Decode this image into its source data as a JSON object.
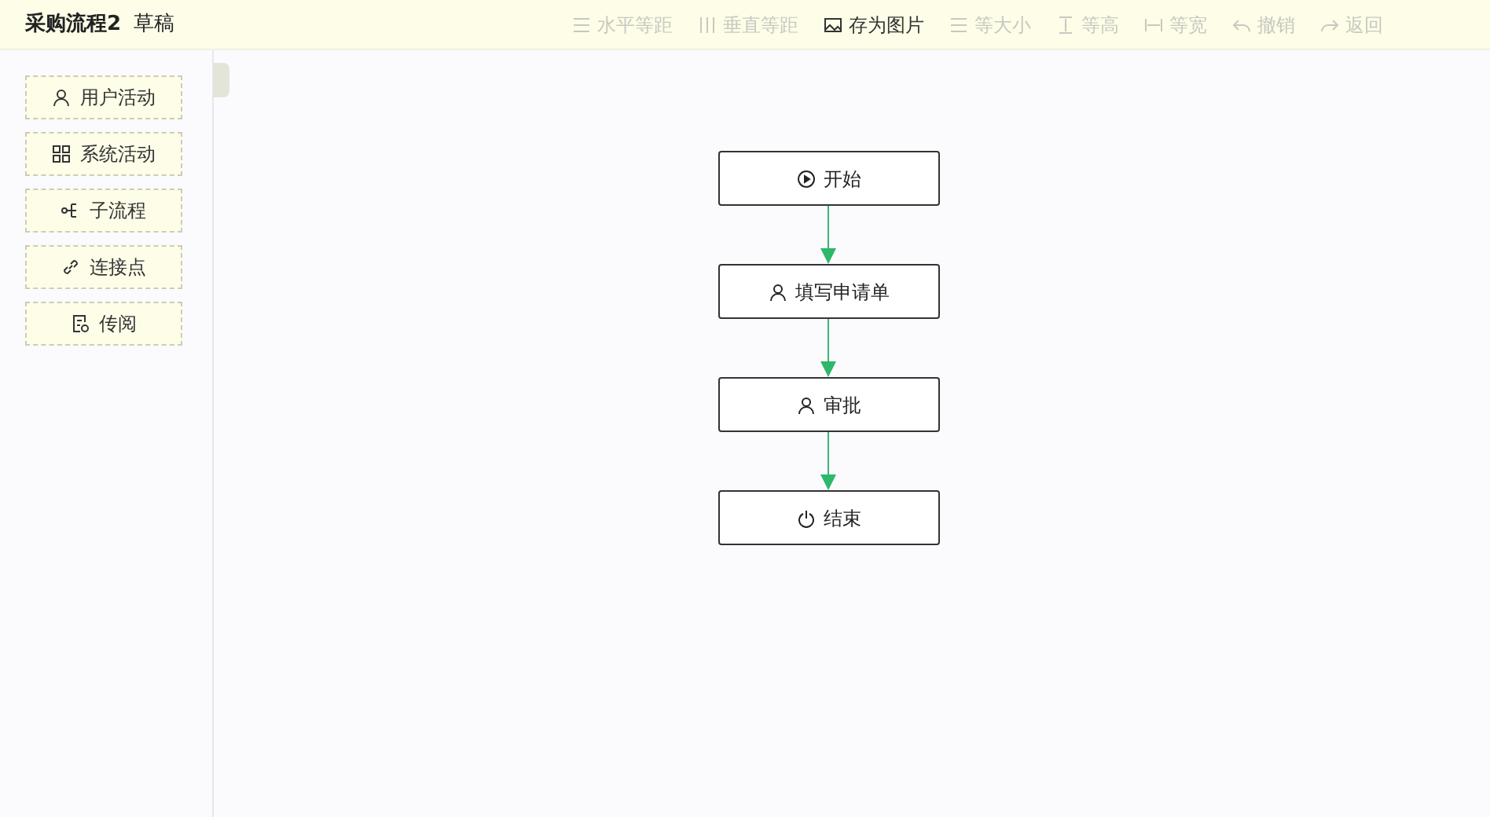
{
  "header": {
    "title": "采购流程2",
    "status": "草稿"
  },
  "toolbar": [
    {
      "kind": "hspace",
      "label": "水平等距",
      "disabled": true
    },
    {
      "kind": "vspace",
      "label": "垂直等距",
      "disabled": true
    },
    {
      "kind": "image",
      "label": "存为图片",
      "disabled": false
    },
    {
      "kind": "samesize",
      "label": "等大小",
      "disabled": true
    },
    {
      "kind": "sameheight",
      "label": "等高",
      "disabled": true
    },
    {
      "kind": "samewidth",
      "label": "等宽",
      "disabled": true
    },
    {
      "kind": "undo",
      "label": "撤销",
      "disabled": true
    },
    {
      "kind": "redo",
      "label": "返回",
      "disabled": true
    }
  ],
  "palette": [
    {
      "kind": "user",
      "label": "用户活动"
    },
    {
      "kind": "system",
      "label": "系统活动"
    },
    {
      "kind": "subflow",
      "label": "子流程"
    },
    {
      "kind": "link",
      "label": "连接点"
    },
    {
      "kind": "circulate",
      "label": "传阅"
    }
  ],
  "flow": {
    "nodes": [
      {
        "kind": "start",
        "label": "开始"
      },
      {
        "kind": "user",
        "label": "填写申请单"
      },
      {
        "kind": "user",
        "label": "审批"
      },
      {
        "kind": "end",
        "label": "结束"
      }
    ]
  }
}
